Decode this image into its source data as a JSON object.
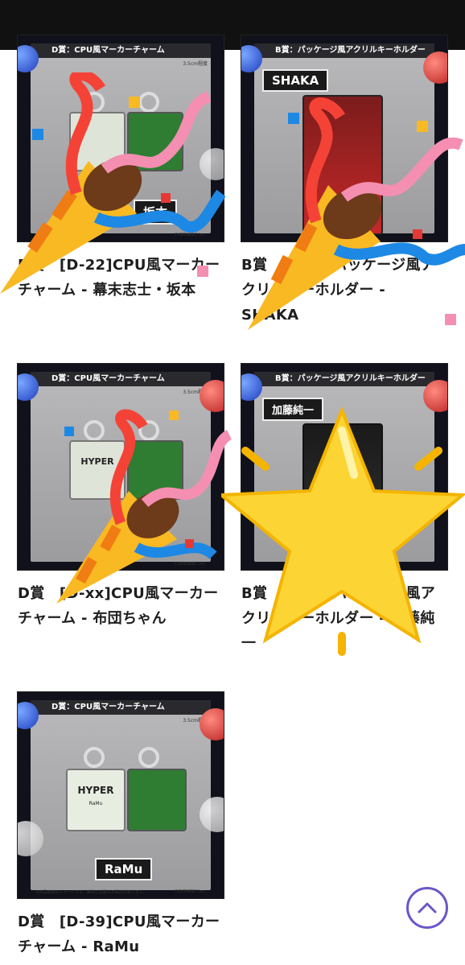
{
  "products": [
    {
      "header": "D賞：CPU風マーカーチャーム",
      "size_note": "3.5cm程度",
      "nameplate": "坂本",
      "footer_left": "※商品画像はイメージです。",
      "footer_right": "©OPENREC Inc.",
      "title": "D賞　[D-22]CPU風マーカーチャーム - 幕末志士・坂本"
    },
    {
      "header": "B賞：パッケージ風アクリルキーホルダー",
      "size_note": "",
      "nameplate": "SHAKA",
      "footer_left": "",
      "footer_right": "",
      "title": "B賞　[B-xx]パッケージ風アクリルキーホルダー - SHAKA"
    },
    {
      "header": "D賞：CPU風マーカーチャーム",
      "size_note": "3.5cm程度",
      "nameplate": "",
      "footer_left": "",
      "footer_right": "©OPENREC Inc.",
      "title": "D賞　[D-xx]CPU風マーカーチャーム - 布団ちゃん"
    },
    {
      "header": "B賞：パッケージ風アクリルキーホルダー",
      "size_note": "",
      "nameplate": "加藤純一",
      "footer_left": "",
      "footer_right": "",
      "title": "B賞　[B-xx]パッケージ風アクリルキーホルダー - 加藤純一"
    },
    {
      "header": "D賞：CPU風マーカーチャーム",
      "size_note": "3.5cm程度",
      "nameplate": "RaMu",
      "footer_left": "※商品画像はイメージです。実際とは異なる場合があります。",
      "footer_right": "©OPENREC Inc.",
      "title": "D賞　[D-39]CPU風マーカーチャーム - RaMu"
    }
  ],
  "charm_label": "HYPER",
  "scroll_top": {
    "icon": "chevron-up-icon"
  },
  "colors": {
    "accent": "#6b57c8",
    "status_bar": "#111111"
  },
  "overlays": [
    "party-popper-icon",
    "party-popper-icon",
    "party-popper-icon",
    "star-icon"
  ]
}
